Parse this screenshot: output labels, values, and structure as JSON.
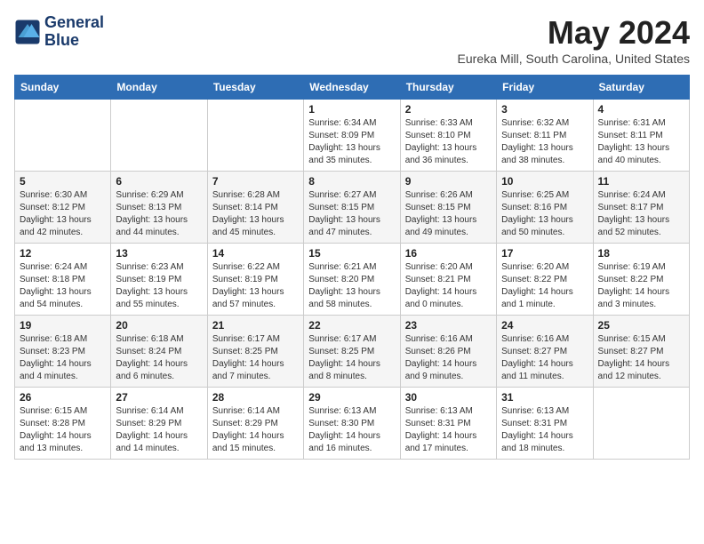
{
  "logo": {
    "line1": "General",
    "line2": "Blue"
  },
  "title": "May 2024",
  "location": "Eureka Mill, South Carolina, United States",
  "days_header": [
    "Sunday",
    "Monday",
    "Tuesday",
    "Wednesday",
    "Thursday",
    "Friday",
    "Saturday"
  ],
  "weeks": [
    [
      {
        "day": "",
        "sunrise": "",
        "sunset": "",
        "daylight": ""
      },
      {
        "day": "",
        "sunrise": "",
        "sunset": "",
        "daylight": ""
      },
      {
        "day": "",
        "sunrise": "",
        "sunset": "",
        "daylight": ""
      },
      {
        "day": "1",
        "sunrise": "Sunrise: 6:34 AM",
        "sunset": "Sunset: 8:09 PM",
        "daylight": "Daylight: 13 hours and 35 minutes."
      },
      {
        "day": "2",
        "sunrise": "Sunrise: 6:33 AM",
        "sunset": "Sunset: 8:10 PM",
        "daylight": "Daylight: 13 hours and 36 minutes."
      },
      {
        "day": "3",
        "sunrise": "Sunrise: 6:32 AM",
        "sunset": "Sunset: 8:11 PM",
        "daylight": "Daylight: 13 hours and 38 minutes."
      },
      {
        "day": "4",
        "sunrise": "Sunrise: 6:31 AM",
        "sunset": "Sunset: 8:11 PM",
        "daylight": "Daylight: 13 hours and 40 minutes."
      }
    ],
    [
      {
        "day": "5",
        "sunrise": "Sunrise: 6:30 AM",
        "sunset": "Sunset: 8:12 PM",
        "daylight": "Daylight: 13 hours and 42 minutes."
      },
      {
        "day": "6",
        "sunrise": "Sunrise: 6:29 AM",
        "sunset": "Sunset: 8:13 PM",
        "daylight": "Daylight: 13 hours and 44 minutes."
      },
      {
        "day": "7",
        "sunrise": "Sunrise: 6:28 AM",
        "sunset": "Sunset: 8:14 PM",
        "daylight": "Daylight: 13 hours and 45 minutes."
      },
      {
        "day": "8",
        "sunrise": "Sunrise: 6:27 AM",
        "sunset": "Sunset: 8:15 PM",
        "daylight": "Daylight: 13 hours and 47 minutes."
      },
      {
        "day": "9",
        "sunrise": "Sunrise: 6:26 AM",
        "sunset": "Sunset: 8:15 PM",
        "daylight": "Daylight: 13 hours and 49 minutes."
      },
      {
        "day": "10",
        "sunrise": "Sunrise: 6:25 AM",
        "sunset": "Sunset: 8:16 PM",
        "daylight": "Daylight: 13 hours and 50 minutes."
      },
      {
        "day": "11",
        "sunrise": "Sunrise: 6:24 AM",
        "sunset": "Sunset: 8:17 PM",
        "daylight": "Daylight: 13 hours and 52 minutes."
      }
    ],
    [
      {
        "day": "12",
        "sunrise": "Sunrise: 6:24 AM",
        "sunset": "Sunset: 8:18 PM",
        "daylight": "Daylight: 13 hours and 54 minutes."
      },
      {
        "day": "13",
        "sunrise": "Sunrise: 6:23 AM",
        "sunset": "Sunset: 8:19 PM",
        "daylight": "Daylight: 13 hours and 55 minutes."
      },
      {
        "day": "14",
        "sunrise": "Sunrise: 6:22 AM",
        "sunset": "Sunset: 8:19 PM",
        "daylight": "Daylight: 13 hours and 57 minutes."
      },
      {
        "day": "15",
        "sunrise": "Sunrise: 6:21 AM",
        "sunset": "Sunset: 8:20 PM",
        "daylight": "Daylight: 13 hours and 58 minutes."
      },
      {
        "day": "16",
        "sunrise": "Sunrise: 6:20 AM",
        "sunset": "Sunset: 8:21 PM",
        "daylight": "Daylight: 14 hours and 0 minutes."
      },
      {
        "day": "17",
        "sunrise": "Sunrise: 6:20 AM",
        "sunset": "Sunset: 8:22 PM",
        "daylight": "Daylight: 14 hours and 1 minute."
      },
      {
        "day": "18",
        "sunrise": "Sunrise: 6:19 AM",
        "sunset": "Sunset: 8:22 PM",
        "daylight": "Daylight: 14 hours and 3 minutes."
      }
    ],
    [
      {
        "day": "19",
        "sunrise": "Sunrise: 6:18 AM",
        "sunset": "Sunset: 8:23 PM",
        "daylight": "Daylight: 14 hours and 4 minutes."
      },
      {
        "day": "20",
        "sunrise": "Sunrise: 6:18 AM",
        "sunset": "Sunset: 8:24 PM",
        "daylight": "Daylight: 14 hours and 6 minutes."
      },
      {
        "day": "21",
        "sunrise": "Sunrise: 6:17 AM",
        "sunset": "Sunset: 8:25 PM",
        "daylight": "Daylight: 14 hours and 7 minutes."
      },
      {
        "day": "22",
        "sunrise": "Sunrise: 6:17 AM",
        "sunset": "Sunset: 8:25 PM",
        "daylight": "Daylight: 14 hours and 8 minutes."
      },
      {
        "day": "23",
        "sunrise": "Sunrise: 6:16 AM",
        "sunset": "Sunset: 8:26 PM",
        "daylight": "Daylight: 14 hours and 9 minutes."
      },
      {
        "day": "24",
        "sunrise": "Sunrise: 6:16 AM",
        "sunset": "Sunset: 8:27 PM",
        "daylight": "Daylight: 14 hours and 11 minutes."
      },
      {
        "day": "25",
        "sunrise": "Sunrise: 6:15 AM",
        "sunset": "Sunset: 8:27 PM",
        "daylight": "Daylight: 14 hours and 12 minutes."
      }
    ],
    [
      {
        "day": "26",
        "sunrise": "Sunrise: 6:15 AM",
        "sunset": "Sunset: 8:28 PM",
        "daylight": "Daylight: 14 hours and 13 minutes."
      },
      {
        "day": "27",
        "sunrise": "Sunrise: 6:14 AM",
        "sunset": "Sunset: 8:29 PM",
        "daylight": "Daylight: 14 hours and 14 minutes."
      },
      {
        "day": "28",
        "sunrise": "Sunrise: 6:14 AM",
        "sunset": "Sunset: 8:29 PM",
        "daylight": "Daylight: 14 hours and 15 minutes."
      },
      {
        "day": "29",
        "sunrise": "Sunrise: 6:13 AM",
        "sunset": "Sunset: 8:30 PM",
        "daylight": "Daylight: 14 hours and 16 minutes."
      },
      {
        "day": "30",
        "sunrise": "Sunrise: 6:13 AM",
        "sunset": "Sunset: 8:31 PM",
        "daylight": "Daylight: 14 hours and 17 minutes."
      },
      {
        "day": "31",
        "sunrise": "Sunrise: 6:13 AM",
        "sunset": "Sunset: 8:31 PM",
        "daylight": "Daylight: 14 hours and 18 minutes."
      },
      {
        "day": "",
        "sunrise": "",
        "sunset": "",
        "daylight": ""
      }
    ]
  ]
}
